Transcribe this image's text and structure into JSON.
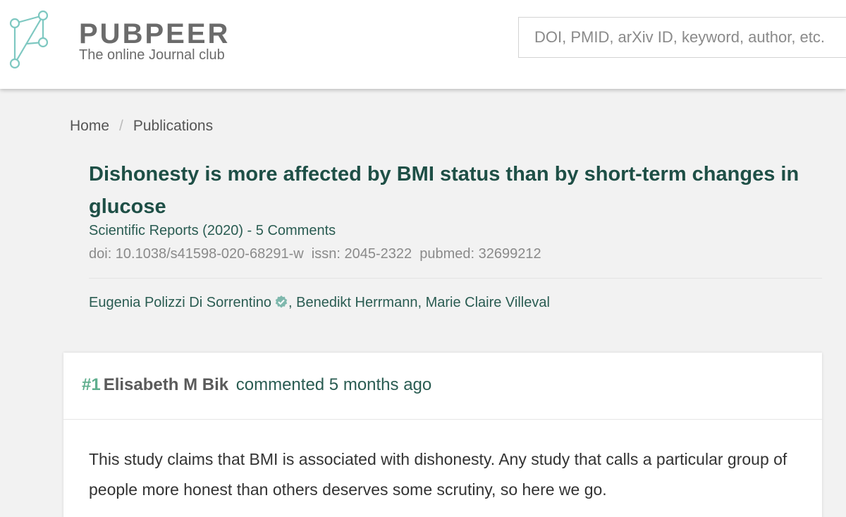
{
  "header": {
    "brand_name": "PUBPEER",
    "tagline": "The online Journal club",
    "search_placeholder": "DOI, PMID, arXiv ID, keyword, author, etc."
  },
  "breadcrumb": {
    "home": "Home",
    "separator": "/",
    "publications": "Publications"
  },
  "publication": {
    "title": "Dishonesty is more affected by BMI status than by short-term changes in glucose",
    "journal_line": "Scientific Reports (2020) - 5 Comments",
    "ids_line": "doi: 10.1038/s41598-020-68291-w  issn: 2045-2322  pubmed: 32699212",
    "authors": {
      "first": "Eugenia Polizzi Di Sorrentino",
      "rest": ", Benedikt Herrmann, Marie Claire Villeval"
    }
  },
  "comment": {
    "number": "#1",
    "author": "Elisabeth M Bik",
    "meta": "commented 5 months ago",
    "body": "This study claims that BMI is associated with dishonesty. Any study that calls a particular group of people more honest than others deserves some scrutiny, so here we go."
  },
  "colors": {
    "logo": "#7ec8c1",
    "title": "#1e4f46",
    "accent_green": "#5fae8e",
    "verified": "#7fb8ad"
  }
}
